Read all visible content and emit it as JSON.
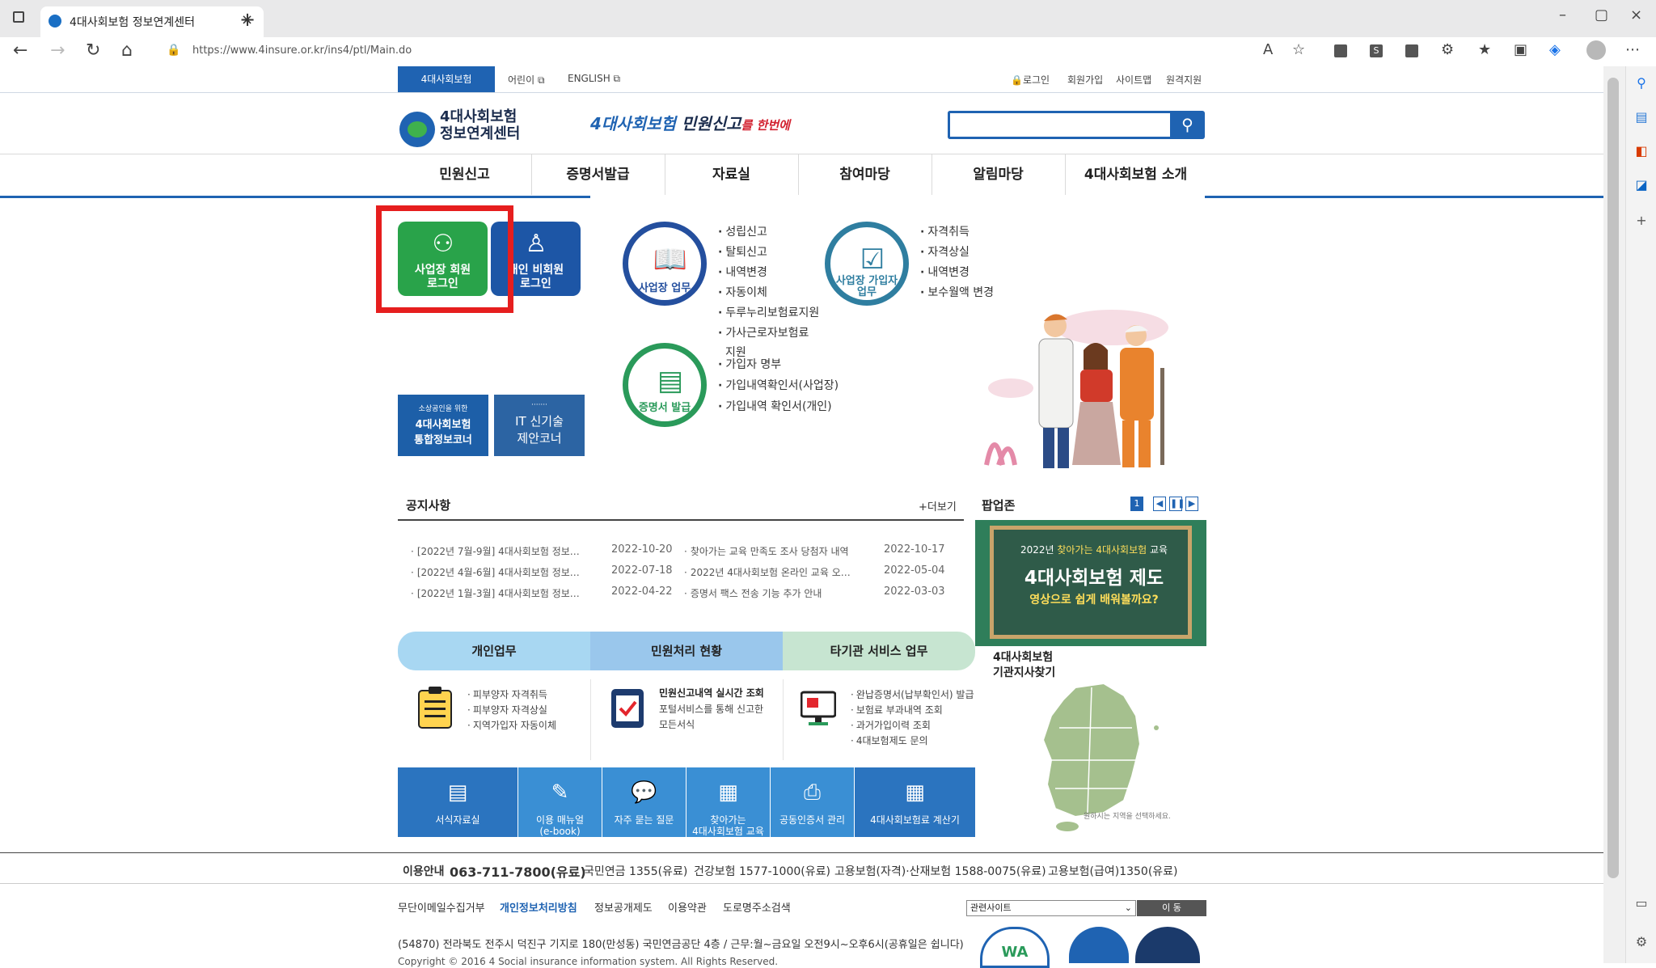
{
  "browser": {
    "tab_title": "4대사회보험 정보연계센터",
    "url": "https://www.4insure.or.kr/ins4/ptl/Main.do",
    "url_host": "4insure.or.kr"
  },
  "site": {
    "brand_tab": "4대사회보험",
    "toplinks": {
      "kids": "어린이",
      "english": "ENGLISH",
      "login": "로그인",
      "join": "회원가입",
      "sitemap": "사이트맵",
      "remote": "원격지원"
    },
    "logo_line1": "4대사회보험",
    "logo_line2": "정보연계센터",
    "slogan_a": "4대사회보험",
    "slogan_b": "민원신고",
    "slogan_c": "를 한번에",
    "gnb": [
      "민원신고",
      "증명서발급",
      "자료실",
      "참여마당",
      "알림마당",
      "4대사회보험 소개"
    ]
  },
  "login": {
    "biz_line1": "사업장 회원",
    "biz_line2": "로그인",
    "personal_line1": "개인 비회원",
    "personal_line2": "로그인"
  },
  "banners": {
    "b1_small": "소상공인을 위한",
    "b1_line1": "4대사회보험",
    "b1_line2": "통합정보코너",
    "b2_line1": "IT 신기술",
    "b2_line2": "제안코너"
  },
  "tasks": {
    "biz_label": "사업장 업무",
    "biz_items": [
      "성립신고",
      "탈퇴신고",
      "내역변경",
      "자동이체",
      "두루누리보험료지원",
      "가사근로자보험료",
      "지원"
    ],
    "member_label_1": "사업장 가입자",
    "member_label_2": "업무",
    "member_items": [
      "자격취득",
      "자격상실",
      "내역변경",
      "보수월액 변경"
    ],
    "cert_label": "증명서 발급",
    "cert_items": [
      "가입자 명부",
      "가입내역확인서(사업장)",
      "가입내역 확인서(개인)"
    ]
  },
  "notices": {
    "title": "공지사항",
    "more": "+더보기",
    "left": [
      {
        "title": "[2022년 7월-9월] 4대사회보험 정보…",
        "date": "2022-10-20"
      },
      {
        "title": "[2022년 4월-6월] 4대사회보험 정보…",
        "date": "2022-07-18"
      },
      {
        "title": "[2022년 1월-3월] 4대사회보험 정보…",
        "date": "2022-04-22"
      }
    ],
    "right": [
      {
        "title": "찾아가는 교육 만족도 조사 당첨자 내역",
        "date": "2022-10-17"
      },
      {
        "title": "2022년 4대사회보험 온라인 교육 오…",
        "date": "2022-05-04"
      },
      {
        "title": "증명서 팩스 전송 기능 추가 안내",
        "date": "2022-03-03"
      }
    ]
  },
  "popup": {
    "title": "팝업존",
    "page": "1",
    "board_t1_a": "2022년 ",
    "board_t1_b": "찾아가는 4대사회보험",
    "board_t1_c": " 교육",
    "board_t2": "4대사회보험 제도",
    "board_t3": "영상으로 쉽게 배워볼까요?"
  },
  "services": {
    "tabs": [
      "개인업무",
      "민원처리 현황",
      "타기관 서비스 업무"
    ],
    "personal": [
      "피부양자 자격취득",
      "피부양자 자격상실",
      "지역가입자 자동이체"
    ],
    "status_title": "민원신고내역 실시간 조회",
    "status_desc_1": "포털서비스를 통해 신고한",
    "status_desc_2": "모든서식",
    "other": [
      "완납증명서(납부확인서) 발급",
      "보험료 부과내역 조회",
      "과거가입이력 조회",
      "4대보험제도 문의"
    ]
  },
  "quickmenu": [
    {
      "label": "서식자료실",
      "label2": ""
    },
    {
      "label": "이용 매뉴얼",
      "label2": "(e-book)"
    },
    {
      "label": "자주 묻는 질문",
      "label2": ""
    },
    {
      "label": "찾아가는",
      "label2": "4대사회보험 교육"
    },
    {
      "label": "공동인증서 관리",
      "label2": ""
    },
    {
      "label": "4대사회보험료 계산기",
      "label2": ""
    }
  ],
  "branch": {
    "title_1": "4대사회보험",
    "title_2": "기관지사찾기",
    "hint": "원하시는 지역을 선택하세요."
  },
  "footer": {
    "guide_label": "이용안내",
    "guide_phone": "063-711-7800(유료)",
    "contacts": [
      "국민연금 1355(유료)",
      "건강보험 1577-1000(유료)",
      "고용보험(자격)·산재보험 1588-0075(유료)",
      "고용보험(급여)1350(유료)"
    ],
    "links": [
      "무단이메일수집거부",
      "개인정보처리방침",
      "정보공개제도",
      "이용약관",
      "도로명주소검색"
    ],
    "select_label": "관련사이트",
    "go_label": "이 동",
    "address": "(54870) 전라북도 전주시 덕진구 기지로 180(만성동) 국민연금공단 4층 / 근무:월~금요일 오전9시~오후6시(공휴일은 쉽니다)",
    "copyright": "Copyright © 2016 4 Social insurance information system. All Rights Reserved."
  },
  "colors": {
    "primary": "#1f63b2",
    "green": "#29a34a",
    "highlight": "#e61e1e",
    "quick": "#3a8fd4"
  }
}
